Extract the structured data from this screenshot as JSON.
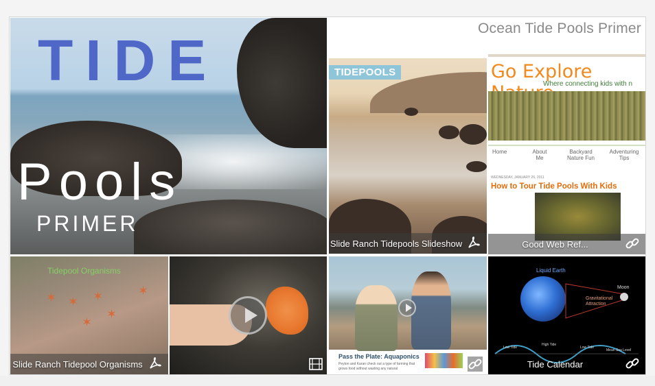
{
  "board": {
    "title": "Ocean Tide Pools Primer"
  },
  "tiles": {
    "main": {
      "word1": "TIDE",
      "word2": "Pools",
      "word3": "PRIMER",
      "colors": {
        "word1": "#4f67c6",
        "word2": "#ffffff"
      }
    },
    "slideshow": {
      "image_label": "TIDEPOOLS",
      "caption": "Slide Ranch Tidepools Slideshow",
      "badge_icon": "pdf-icon"
    },
    "website": {
      "site_title": "Go Explore Nature",
      "site_subtitle": "Where connecting kids with n",
      "nav": [
        "Home",
        "About Me",
        "Backyard Nature Fun",
        "Adventuring Tips"
      ],
      "post_date": "WEDNESDAY, JANUARY 26, 2011",
      "post_title": "How to Tour Tide Pools With Kids",
      "caption": "Good Web Ref...",
      "badge_icon": "link-icon"
    },
    "organisms": {
      "image_label": "Tidepool Organisms",
      "caption": "Slide Ranch Tidepool Organisms",
      "badge_icon": "pdf-icon"
    },
    "video": {
      "badge_icon": "film-icon"
    },
    "aquaponics": {
      "title": "Pass the Plate: Aquaponics",
      "description": "Peyton and Karan check out a type of farming that grows food without wasting any natural",
      "badge_icon": "link-icon"
    },
    "calendar": {
      "diagram_title": "Liquid Earth",
      "moon_label": "Moon",
      "gravity_label": "Gravitational Attraction",
      "high_tide": "High Tide",
      "low_tide_left": "Low Tide",
      "low_tide_right": "Low Tide",
      "sea_level": "Mean Sea Level",
      "caption": "Tide Calendar",
      "badge_icon": "link-icon"
    }
  }
}
